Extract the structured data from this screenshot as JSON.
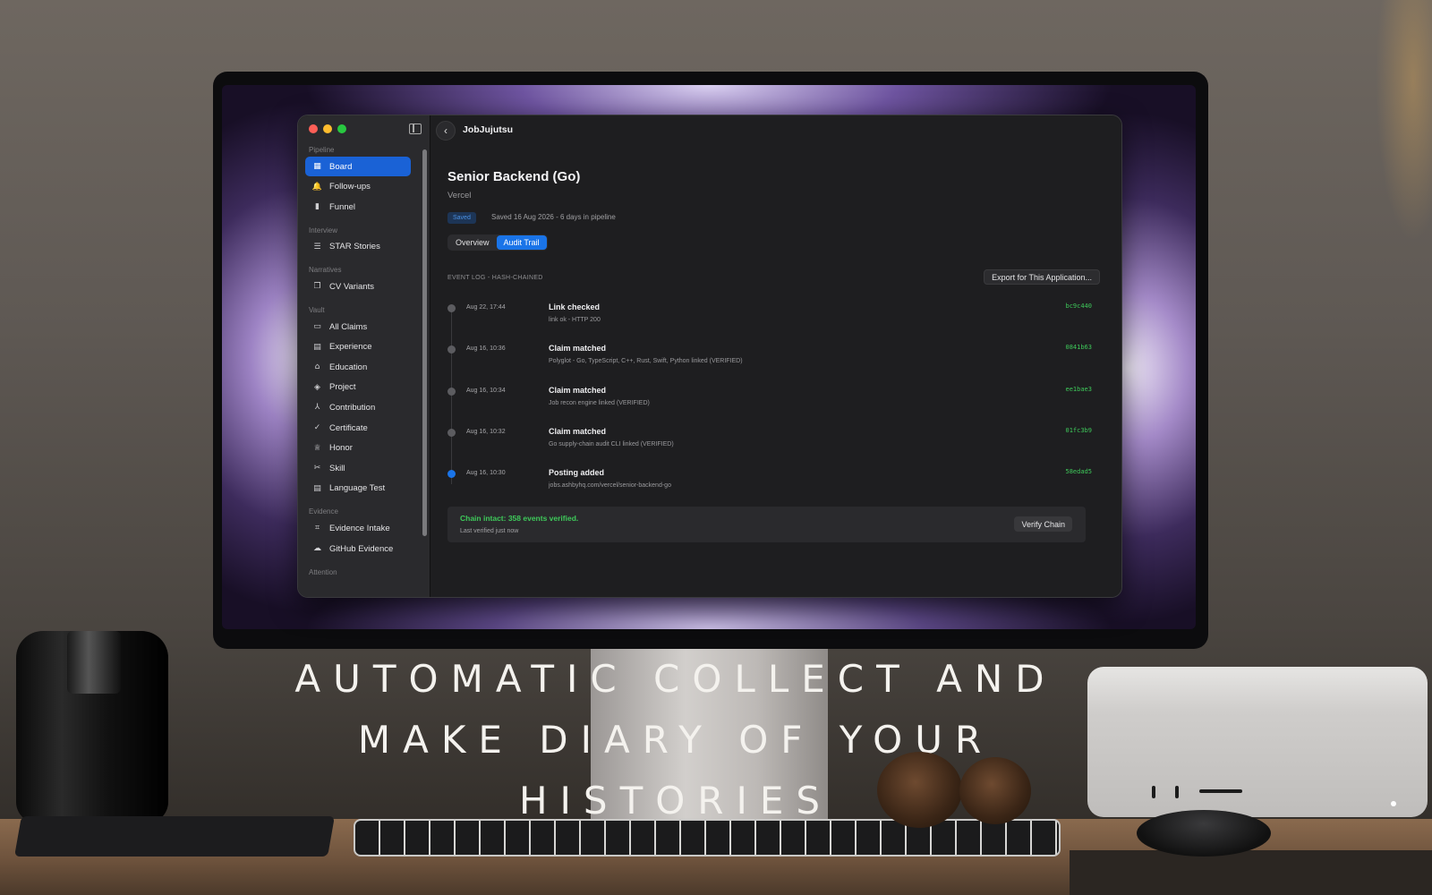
{
  "app": {
    "title": "JobJujutsu"
  },
  "sidebar": {
    "sections": [
      {
        "label": "Pipeline",
        "items": [
          {
            "label": "Board",
            "icon": "board-icon",
            "active": true
          },
          {
            "label": "Follow-ups",
            "icon": "bell-icon"
          },
          {
            "label": "Funnel",
            "icon": "bar-chart-icon"
          }
        ]
      },
      {
        "label": "Interview",
        "items": [
          {
            "label": "STAR Stories",
            "icon": "list-icon"
          }
        ]
      },
      {
        "label": "Narratives",
        "items": [
          {
            "label": "CV Variants",
            "icon": "documents-icon"
          }
        ]
      },
      {
        "label": "Vault",
        "items": [
          {
            "label": "All Claims",
            "icon": "tray-icon"
          },
          {
            "label": "Experience",
            "icon": "briefcase-icon"
          },
          {
            "label": "Education",
            "icon": "graduation-cap-icon"
          },
          {
            "label": "Project",
            "icon": "cube-icon"
          },
          {
            "label": "Contribution",
            "icon": "merge-icon"
          },
          {
            "label": "Certificate",
            "icon": "check-seal-icon"
          },
          {
            "label": "Honor",
            "icon": "trophy-icon"
          },
          {
            "label": "Skill",
            "icon": "tools-icon"
          },
          {
            "label": "Language Test",
            "icon": "doc-text-icon"
          }
        ]
      },
      {
        "label": "Evidence",
        "items": [
          {
            "label": "Evidence Intake",
            "icon": "scan-icon"
          },
          {
            "label": "GitHub Evidence",
            "icon": "cloud-icon"
          }
        ]
      },
      {
        "label": "Attention",
        "items": []
      }
    ]
  },
  "main": {
    "title": "Senior Backend (Go)",
    "company": "Vercel",
    "status_badge": "Saved",
    "saved_meta": "Saved 16 Aug 2026 - 6 days in pipeline",
    "tabs": [
      {
        "label": "Overview",
        "active": false
      },
      {
        "label": "Audit Trail",
        "active": true
      }
    ],
    "event_log_label": "EVENT LOG - HASH-CHAINED",
    "export_label": "Export for This Application...",
    "events": [
      {
        "time": "Aug 22, 17:44",
        "title": "Link checked",
        "detail": "link ok - HTTP 200",
        "hash": "bc9c440",
        "dot": "gray"
      },
      {
        "time": "Aug 16, 10:36",
        "title": "Claim matched",
        "detail": "Polyglot - Go, TypeScript, C++, Rust, Swift, Python linked (VERIFIED)",
        "hash": "0841b63",
        "dot": "gray"
      },
      {
        "time": "Aug 16, 10:34",
        "title": "Claim matched",
        "detail": "Job recon engine linked (VERIFIED)",
        "hash": "ee1bae3",
        "dot": "gray"
      },
      {
        "time": "Aug 16, 10:32",
        "title": "Claim matched",
        "detail": "Go supply-chain audit CLI linked (VERIFIED)",
        "hash": "01fc3b9",
        "dot": "gray"
      },
      {
        "time": "Aug 16, 10:30",
        "title": "Posting added",
        "detail": "jobs.ashbyhq.com/vercel/senior-backend-go",
        "hash": "58edad5",
        "dot": "blue"
      }
    ],
    "chain_status": "Chain intact: 358 events verified.",
    "chain_sub": "Last verified just now",
    "verify_label": "Verify Chain"
  },
  "headline": {
    "lines": [
      "AUTOMATIC COLLECT AND",
      "MAKE DIARY OF YOUR",
      "HISTORIES"
    ]
  },
  "colors": {
    "accent": "#1a74e8",
    "hash_green": "#3ec95a",
    "window_bg": "#1e1e20",
    "sidebar_bg": "#2a2a2d"
  }
}
